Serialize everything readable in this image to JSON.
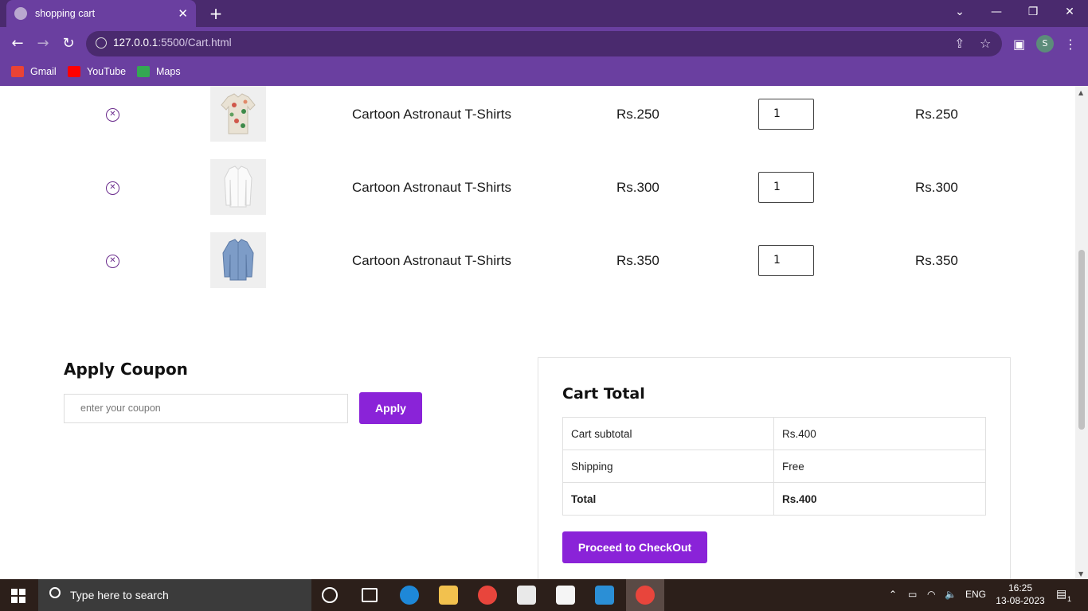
{
  "browser": {
    "tab_title": "shopping cart",
    "tab_close": "✕",
    "new_tab": "+",
    "url_host": "127.0.0.1",
    "url_path": ":5500/Cart.html",
    "profile_initial": "S",
    "controls": {
      "dropdown": "⌄",
      "minimize": "—",
      "restore": "❐",
      "close": "✕"
    },
    "bookmarks": [
      {
        "label": "Gmail",
        "color": "#ea4335"
      },
      {
        "label": "YouTube",
        "color": "#ff0000"
      },
      {
        "label": "Maps",
        "color": "#34a853"
      }
    ]
  },
  "cart": {
    "remove_symbol": "✕",
    "items": [
      {
        "name": "Cartoon Astronaut T-Shirts",
        "price": "Rs.250",
        "qty": "1",
        "subtotal": "Rs.250",
        "image": "floral-shirt"
      },
      {
        "name": "Cartoon Astronaut T-Shirts",
        "price": "Rs.300",
        "qty": "1",
        "subtotal": "Rs.300",
        "image": "white-shirt"
      },
      {
        "name": "Cartoon Astronaut T-Shirts",
        "price": "Rs.350",
        "qty": "1",
        "subtotal": "Rs.350",
        "image": "denim-shirt"
      }
    ]
  },
  "coupon": {
    "title": "Apply Coupon",
    "placeholder": "enter your coupon",
    "apply_label": "Apply"
  },
  "cart_total": {
    "title": "Cart Total",
    "rows": [
      {
        "label": "Cart subtotal",
        "value": "Rs.400"
      },
      {
        "label": "Shipping",
        "value": "Free"
      },
      {
        "label": "Total",
        "value": "Rs.400"
      }
    ],
    "checkout_label": "Proceed to CheckOut"
  },
  "taskbar": {
    "search_placeholder": "Type here to search",
    "language": "ENG",
    "time": "16:25",
    "date": "13-08-2023",
    "notification_count": "1"
  },
  "colors": {
    "accent": "#8a23d8",
    "browser_frame": "#6a3fa0",
    "remove_icon": "#6a2b8c"
  }
}
